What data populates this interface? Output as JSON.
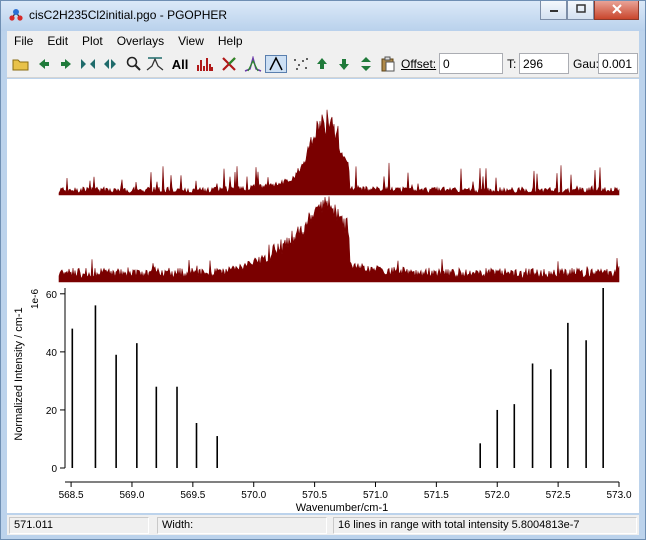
{
  "window": {
    "title": "cisC2H235Cl2initial.pgo - PGOPHER",
    "minimize_icon": "minimize-icon",
    "maximize_icon": "maximize-icon",
    "close_icon": "close-icon"
  },
  "menu": [
    "File",
    "Edit",
    "Plot",
    "Overlays",
    "View",
    "Help"
  ],
  "toolbar": {
    "all_label": "All",
    "offset_label": "Offset:",
    "offset_value": "0",
    "t_label": "T:",
    "t_value": "296",
    "gau_label": "Gau:",
    "gau_value": "0.001"
  },
  "status": {
    "position": "571.011",
    "width_label": "Width:",
    "width_value": "",
    "message": "16 lines in range with total intensity 5.8004813e-7"
  },
  "colors": {
    "spectrum": "#7a0000",
    "sticks": "#000000",
    "titlebar": "#c4d9f0"
  },
  "chart_data": {
    "type": "bar",
    "xlabel": "Wavenumber/cm-1",
    "ylabel": "Normalized Intensity / cm-1",
    "y_multiplier": "1e-6",
    "xlim": [
      568.45,
      573.0
    ],
    "ylim": [
      0,
      62
    ],
    "xticks": [
      "568.5",
      "569.0",
      "569.5",
      "570.0",
      "570.5",
      "571.0",
      "571.5",
      "572.0",
      "572.5",
      "573.0"
    ],
    "xtick_values": [
      568.5,
      569.0,
      569.5,
      570.0,
      570.5,
      571.0,
      571.5,
      572.0,
      572.5,
      573.0
    ],
    "yticks": [
      "0",
      "20",
      "40",
      "60"
    ],
    "ytick_values": [
      0,
      20,
      40,
      60
    ],
    "series": [
      {
        "x": [
          568.51,
          568.7,
          568.87,
          569.04,
          569.2,
          569.37,
          569.53,
          569.7,
          571.86,
          572.0,
          572.14,
          572.29,
          572.44,
          572.58,
          572.73,
          572.87
        ],
        "values": [
          48,
          56,
          39,
          43,
          28,
          28,
          15.5,
          11,
          8.5,
          20,
          22,
          36,
          34,
          50,
          44,
          62
        ]
      }
    ],
    "grid": false
  }
}
